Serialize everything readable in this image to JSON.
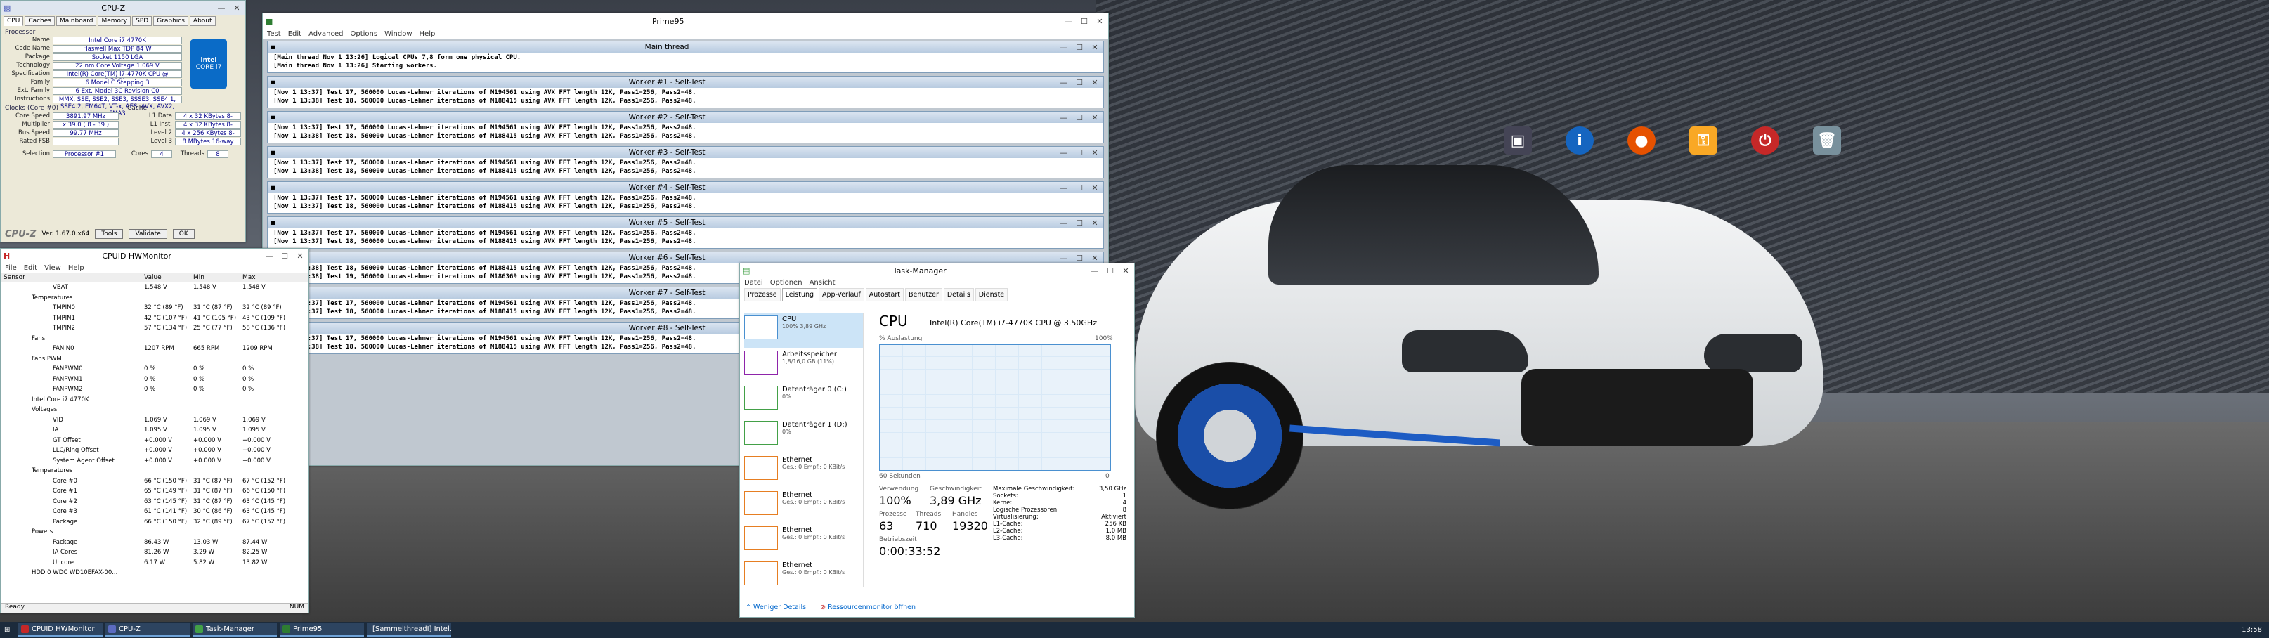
{
  "cpuz": {
    "title": "CPU-Z",
    "tabs": [
      "CPU",
      "Caches",
      "Mainboard",
      "Memory",
      "SPD",
      "Graphics",
      "About"
    ],
    "section_processor": "Processor",
    "rows": [
      {
        "k": "Name",
        "v": "Intel Core i7 4770K"
      },
      {
        "k": "Code Name",
        "v": "Haswell      Max TDP 84 W"
      },
      {
        "k": "Package",
        "v": "Socket 1150 LGA"
      },
      {
        "k": "Technology",
        "v": "22 nm   Core Voltage 1.069 V"
      },
      {
        "k": "Specification",
        "v": "Intel(R) Core(TM) i7-4770K CPU @ 3.50GHz"
      },
      {
        "k": "Family",
        "v": "6    Model C    Stepping 3"
      },
      {
        "k": "Ext. Family",
        "v": "6    Ext. Model 3C    Revision C0"
      },
      {
        "k": "Instructions",
        "v": "MMX, SSE, SSE2, SSE3, SSSE3, SSE4.1, SSE4.2, EM64T, VT-x, AES, AVX, AVX2, FMA3"
      }
    ],
    "section_clocks": "Clocks (Core #0)",
    "clocks": [
      {
        "k": "Core Speed",
        "v": "3891.97 MHz"
      },
      {
        "k": "Multiplier",
        "v": "x 39.0 ( 8 - 39 )"
      },
      {
        "k": "Bus Speed",
        "v": "99.77 MHz"
      },
      {
        "k": "Rated FSB",
        "v": ""
      }
    ],
    "section_cache": "Cache",
    "cache": [
      {
        "k": "L1 Data",
        "v": "4 x 32 KBytes  8-way"
      },
      {
        "k": "L1 Inst.",
        "v": "4 x 32 KBytes  8-way"
      },
      {
        "k": "Level 2",
        "v": "4 x 256 KBytes  8-way"
      },
      {
        "k": "Level 3",
        "v": "8 MBytes  16-way"
      }
    ],
    "intel_badge": "intel\nCORE i7",
    "selection_label": "Selection",
    "selection_value": "Processor #1",
    "cores_label": "Cores",
    "cores_value": "4",
    "threads_label": "Threads",
    "threads_value": "8",
    "version": "Ver. 1.67.0.x64",
    "tools_btn": "Tools",
    "validate_btn": "Validate",
    "ok_btn": "OK"
  },
  "hwmonitor": {
    "title": "CPUID HWMonitor",
    "menu": [
      "File",
      "Edit",
      "View",
      "Help"
    ],
    "columns": [
      "Sensor",
      "Value",
      "Min",
      "Max"
    ],
    "rows": [
      [
        "VBAT",
        "1.548 V",
        "1.548 V",
        "1.548 V"
      ],
      [
        "Temperatures",
        "",
        "",
        ""
      ],
      [
        "TMPIN0",
        "32 °C (89 °F)",
        "31 °C (87 °F)",
        "32 °C (89 °F)"
      ],
      [
        "TMPIN1",
        "42 °C (107 °F)",
        "41 °C (105 °F)",
        "43 °C (109 °F)"
      ],
      [
        "TMPIN2",
        "57 °C (134 °F)",
        "25 °C (77 °F)",
        "58 °C (136 °F)"
      ],
      [
        "Fans",
        "",
        "",
        ""
      ],
      [
        "FANIN0",
        "1207 RPM",
        "665 RPM",
        "1209 RPM"
      ],
      [
        "Fans PWM",
        "",
        "",
        ""
      ],
      [
        "FANPWM0",
        "0 %",
        "0 %",
        "0 %"
      ],
      [
        "FANPWM1",
        "0 %",
        "0 %",
        "0 %"
      ],
      [
        "FANPWM2",
        "0 %",
        "0 %",
        "0 %"
      ],
      [
        "Intel Core i7 4770K",
        "",
        "",
        ""
      ],
      [
        "Voltages",
        "",
        "",
        ""
      ],
      [
        "VID",
        "1.069 V",
        "1.069 V",
        "1.069 V"
      ],
      [
        "IA",
        "1.095 V",
        "1.095 V",
        "1.095 V"
      ],
      [
        "GT Offset",
        "+0.000 V",
        "+0.000 V",
        "+0.000 V"
      ],
      [
        "LLC/Ring Offset",
        "+0.000 V",
        "+0.000 V",
        "+0.000 V"
      ],
      [
        "System Agent Offset",
        "+0.000 V",
        "+0.000 V",
        "+0.000 V"
      ],
      [
        "Temperatures",
        "",
        "",
        ""
      ],
      [
        "Core #0",
        "66 °C (150 °F)",
        "31 °C (87 °F)",
        "67 °C (152 °F)"
      ],
      [
        "Core #1",
        "65 °C (149 °F)",
        "31 °C (87 °F)",
        "66 °C (150 °F)"
      ],
      [
        "Core #2",
        "63 °C (145 °F)",
        "31 °C (87 °F)",
        "63 °C (145 °F)"
      ],
      [
        "Core #3",
        "61 °C (141 °F)",
        "30 °C (86 °F)",
        "63 °C (145 °F)"
      ],
      [
        "Package",
        "66 °C (150 °F)",
        "32 °C (89 °F)",
        "67 °C (152 °F)"
      ],
      [
        "Powers",
        "",
        "",
        ""
      ],
      [
        "Package",
        "86.43 W",
        "13.03 W",
        "87.44 W"
      ],
      [
        "IA Cores",
        "81.26 W",
        "3.29 W",
        "82.25 W"
      ],
      [
        "Uncore",
        "6.17 W",
        "5.82 W",
        "13.82 W"
      ],
      [
        "HDD 0 WDC WD10EFAX-00...",
        "",
        "",
        ""
      ]
    ],
    "status_left": "Ready",
    "status_right": "NUM"
  },
  "prime95": {
    "title": "Prime95",
    "menu": [
      "Test",
      "Edit",
      "Advanced",
      "Options",
      "Window",
      "Help"
    ],
    "panes": [
      {
        "title": "Main thread",
        "lines": [
          "[Main thread Nov 1 13:26] Logical CPUs 7,8 form one physical CPU.",
          "[Main thread Nov 1 13:26] Starting workers."
        ]
      },
      {
        "title": "Worker #1 - Self-Test",
        "lines": [
          "[Nov 1 13:37] Test 17, 560000 Lucas-Lehmer iterations of M194561 using AVX FFT length 12K, Pass1=256, Pass2=48.",
          "[Nov 1 13:38] Test 18, 560000 Lucas-Lehmer iterations of M188415 using AVX FFT length 12K, Pass1=256, Pass2=48."
        ]
      },
      {
        "title": "Worker #2 - Self-Test",
        "lines": [
          "[Nov 1 13:37] Test 17, 560000 Lucas-Lehmer iterations of M194561 using AVX FFT length 12K, Pass1=256, Pass2=48.",
          "[Nov 1 13:38] Test 18, 560000 Lucas-Lehmer iterations of M188415 using AVX FFT length 12K, Pass1=256, Pass2=48."
        ]
      },
      {
        "title": "Worker #3 - Self-Test",
        "lines": [
          "[Nov 1 13:37] Test 17, 560000 Lucas-Lehmer iterations of M194561 using AVX FFT length 12K, Pass1=256, Pass2=48.",
          "[Nov 1 13:38] Test 18, 560000 Lucas-Lehmer iterations of M188415 using AVX FFT length 12K, Pass1=256, Pass2=48."
        ]
      },
      {
        "title": "Worker #4 - Self-Test",
        "lines": [
          "[Nov 1 13:37] Test 17, 560000 Lucas-Lehmer iterations of M194561 using AVX FFT length 12K, Pass1=256, Pass2=48.",
          "[Nov 1 13:37] Test 18, 560000 Lucas-Lehmer iterations of M188415 using AVX FFT length 12K, Pass1=256, Pass2=48."
        ]
      },
      {
        "title": "Worker #5 - Self-Test",
        "lines": [
          "[Nov 1 13:37] Test 17, 560000 Lucas-Lehmer iterations of M194561 using AVX FFT length 12K, Pass1=256, Pass2=48.",
          "[Nov 1 13:37] Test 18, 560000 Lucas-Lehmer iterations of M188415 using AVX FFT length 12K, Pass1=256, Pass2=48."
        ]
      },
      {
        "title": "Worker #6 - Self-Test",
        "lines": [
          "[Nov 1 13:38] Test 18, 560000 Lucas-Lehmer iterations of M188415 using AVX FFT length 12K, Pass1=256, Pass2=48.",
          "[Nov 1 13:38] Test 19, 560000 Lucas-Lehmer iterations of M186369 using AVX FFT length 12K, Pass1=256, Pass2=48."
        ]
      },
      {
        "title": "Worker #7 - Self-Test",
        "lines": [
          "[Nov 1 13:37] Test 17, 560000 Lucas-Lehmer iterations of M194561 using AVX FFT length 12K, Pass1=256, Pass2=48.",
          "[Nov 1 13:37] Test 18, 560000 Lucas-Lehmer iterations of M188415 using AVX FFT length 12K, Pass1=256, Pass2=48."
        ]
      },
      {
        "title": "Worker #8 - Self-Test",
        "lines": [
          "[Nov 1 13:37] Test 17, 560000 Lucas-Lehmer iterations of M194561 using AVX FFT length 12K, Pass1=256, Pass2=48.",
          "[Nov 1 13:38] Test 18, 560000 Lucas-Lehmer iterations of M188415 using AVX FFT length 12K, Pass1=256, Pass2=48."
        ]
      }
    ]
  },
  "taskmgr": {
    "title": "Task-Manager",
    "menu": [
      "Datei",
      "Optionen",
      "Ansicht"
    ],
    "tabs": [
      "Prozesse",
      "Leistung",
      "App-Verlauf",
      "Autostart",
      "Benutzer",
      "Details",
      "Dienste"
    ],
    "active_tab": "Leistung",
    "items": [
      {
        "name": "CPU",
        "sub": "100% 3,89 GHz"
      },
      {
        "name": "Arbeitsspeicher",
        "sub": "1,8/16,0 GB (11%)"
      },
      {
        "name": "Datenträger 0 (C:)",
        "sub": "0%"
      },
      {
        "name": "Datenträger 1 (D:)",
        "sub": "0%"
      },
      {
        "name": "Ethernet",
        "sub": "Ges.: 0 Empf.: 0 KBit/s"
      },
      {
        "name": "Ethernet",
        "sub": "Ges.: 0 Empf.: 0 KBit/s"
      },
      {
        "name": "Ethernet",
        "sub": "Ges.: 0 Empf.: 0 KBit/s"
      },
      {
        "name": "Ethernet",
        "sub": "Ges.: 0 Empf.: 0 KBit/s"
      }
    ],
    "cpu_heading": "CPU",
    "cpu_model": "Intel(R) Core(TM) i7-4770K CPU @ 3.50GHz",
    "graph_label": "% Auslastung",
    "graph_max": "100%",
    "graph_span": "60 Sekunden",
    "graph_min": "0",
    "utilization": 1.0,
    "stats": {
      "verwendung_label": "Verwendung",
      "verwendung": "100%",
      "geschw_label": "Geschwindigkeit",
      "geschw": "3,89 GHz",
      "prozesse_label": "Prozesse",
      "prozesse": "63",
      "threads_label": "Threads",
      "threads": "710",
      "handles_label": "Handles",
      "handles": "19320",
      "betrieb_label": "Betriebszeit",
      "betrieb": "0:00:33:52"
    },
    "specs": [
      [
        "Maximale Geschwindigkeit:",
        "3,50 GHz"
      ],
      [
        "Sockets:",
        "1"
      ],
      [
        "Kerne:",
        "4"
      ],
      [
        "Logische Prozessoren:",
        "8"
      ],
      [
        "Virtualisierung:",
        "Aktiviert"
      ],
      [
        "L1-Cache:",
        "256 KB"
      ],
      [
        "L2-Cache:",
        "1,0 MB"
      ],
      [
        "L3-Cache:",
        "8,0 MB"
      ]
    ],
    "less_details": "Weniger Details",
    "resmon": "Ressourcenmonitor öffnen"
  },
  "taskbar": {
    "items": [
      {
        "label": "CPUID HWMonitor",
        "color": "#c62828"
      },
      {
        "label": "CPU-Z",
        "color": "#5c6bc0"
      },
      {
        "label": "Task-Manager",
        "color": "#43a047"
      },
      {
        "label": "Prime95",
        "color": "#2e7d32"
      },
      {
        "label": "[SammelthreadI] Intel...",
        "color": "#e65100"
      }
    ],
    "clock": "13:58"
  },
  "colors": {
    "accent": "#4a90d0",
    "intel_blue": "#0a6bc7"
  }
}
